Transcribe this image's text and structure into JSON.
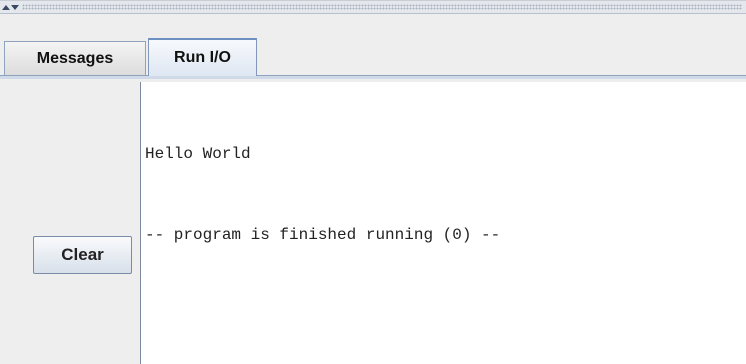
{
  "tabs": {
    "messages_label": "Messages",
    "runio_label": "Run I/O",
    "active": "Run I/O"
  },
  "controls": {
    "clear_label": "Clear"
  },
  "output": {
    "lines": [
      "Hello World",
      "-- program is finished running (0) --"
    ]
  },
  "colors": {
    "background": "#eeeeee",
    "output_background": "#ffffff",
    "active_tab_accent": "#6d8fc1"
  },
  "icons": {
    "divider_up": "arrow-up-icon",
    "divider_down": "arrow-down-icon"
  }
}
